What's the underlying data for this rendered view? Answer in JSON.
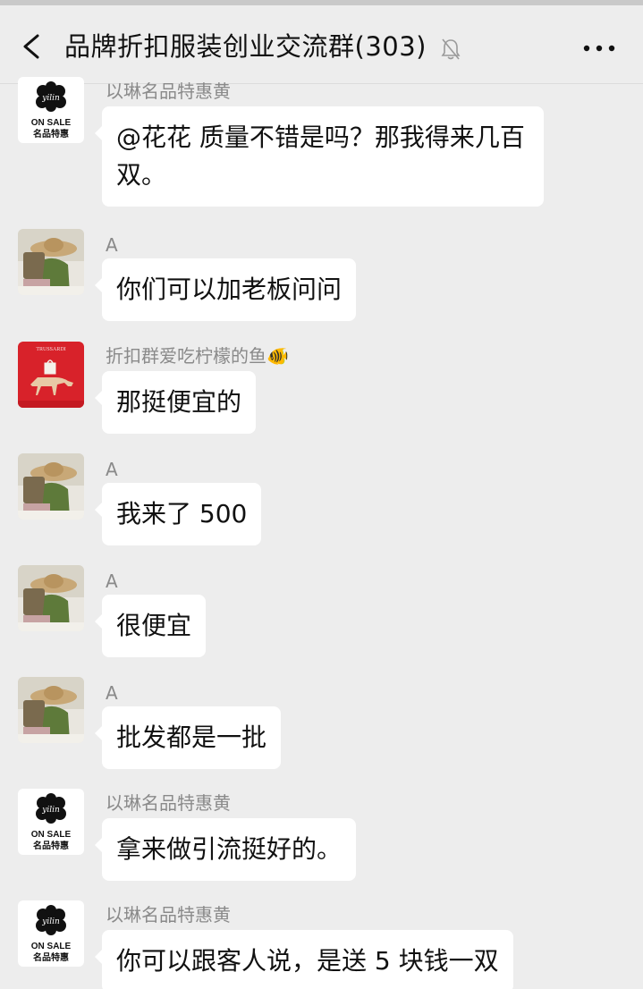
{
  "header": {
    "title": "品牌折扣服装创业交流群(303)",
    "back_icon": "chevron-left-icon",
    "mute_icon": "bell-off-icon",
    "more_icon": "more-dots-icon"
  },
  "avatars": {
    "yilin": {
      "logo_text": "yilin",
      "line1": "ON SALE",
      "line2": "名品特惠"
    },
    "a": {
      "description": "straw-hat-photo"
    },
    "fish": {
      "brand": "TRUSSARDI"
    }
  },
  "messages": [
    {
      "sender": "以琳名品特惠黄",
      "avatar": "yilin",
      "text": "@花花  质量不错是吗？那我得来几百双。"
    },
    {
      "sender": "A",
      "avatar": "a",
      "text": "你们可以加老板问问"
    },
    {
      "sender": "折扣群爱吃柠檬的鱼",
      "sender_emoji": "🐠",
      "avatar": "fish",
      "text": "那挺便宜的"
    },
    {
      "sender": "A",
      "avatar": "a",
      "text": "我来了 500"
    },
    {
      "sender": "A",
      "avatar": "a",
      "text": "很便宜"
    },
    {
      "sender": "A",
      "avatar": "a",
      "text": "批发都是一批"
    },
    {
      "sender": "以琳名品特惠黄",
      "avatar": "yilin",
      "text": "拿来做引流挺好的。"
    },
    {
      "sender": "以琳名品特惠黄",
      "avatar": "yilin",
      "text": "你可以跟客人说，是送 5 块钱一双"
    }
  ]
}
